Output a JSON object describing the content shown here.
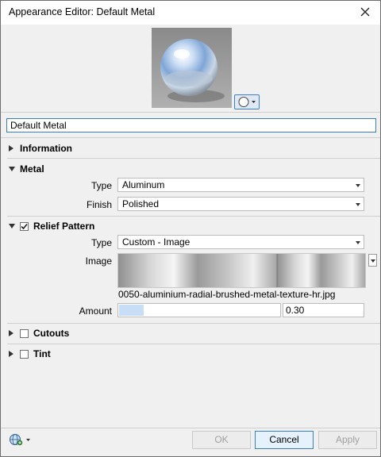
{
  "window": {
    "title": "Appearance Editor: Default Metal"
  },
  "icons": {
    "close": "close-icon",
    "sphere": "sphere-icon",
    "add": "add-globe-icon"
  },
  "name_field": {
    "value": "Default Metal"
  },
  "sections": {
    "information": {
      "label": "Information",
      "expanded": false
    },
    "metal": {
      "label": "Metal",
      "expanded": true,
      "type_label": "Type",
      "type_value": "Aluminum",
      "finish_label": "Finish",
      "finish_value": "Polished"
    },
    "relief": {
      "label": "Relief Pattern",
      "expanded": true,
      "checked": true,
      "type_label": "Type",
      "type_value": "Custom - Image",
      "image_label": "Image",
      "image_filename": "0050-aluminium-radial-brushed-metal-texture-hr.jpg",
      "amount_label": "Amount",
      "amount_value": "0.30",
      "amount_fraction": 0.15
    },
    "cutouts": {
      "label": "Cutouts",
      "expanded": false,
      "checked": false
    },
    "tint": {
      "label": "Tint",
      "expanded": false,
      "checked": false
    }
  },
  "buttons": {
    "ok": "OK",
    "cancel": "Cancel",
    "apply": "Apply"
  },
  "colors": {
    "accent": "#3c7fc1",
    "slider_fill": "#c7def6"
  }
}
